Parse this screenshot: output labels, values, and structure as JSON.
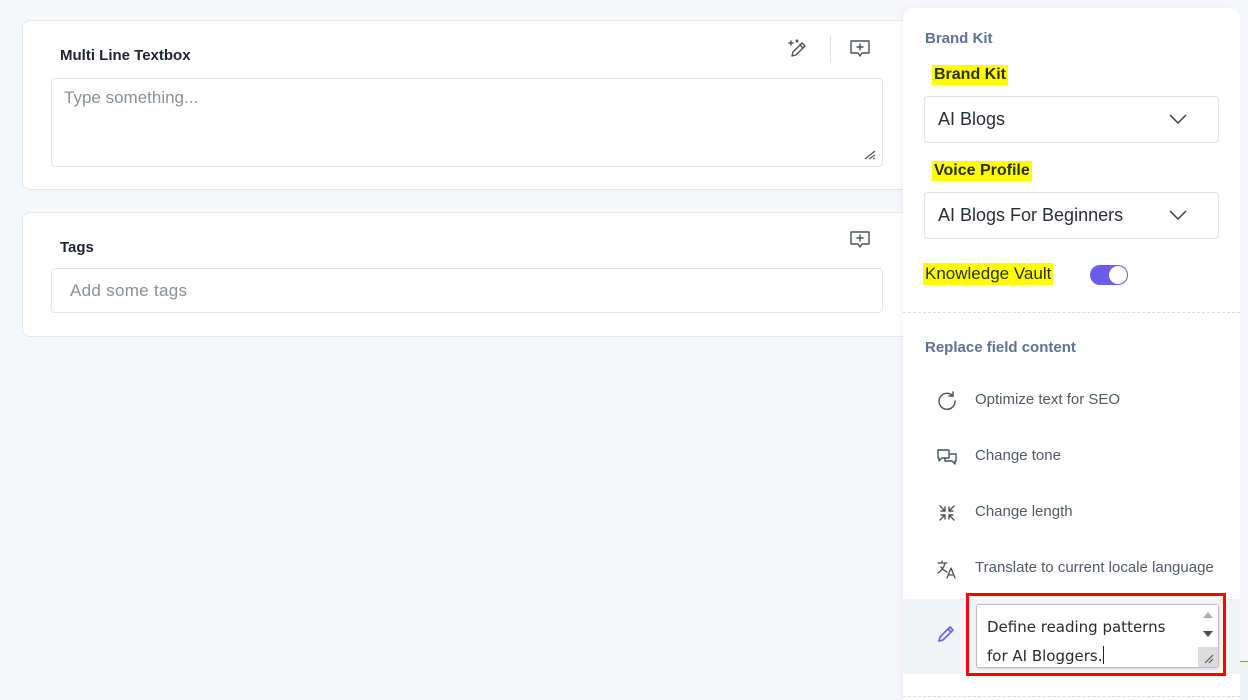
{
  "fields": {
    "multiline": {
      "label": "Multi Line Textbox",
      "placeholder": "Type something...",
      "value": ""
    },
    "tags": {
      "label": "Tags",
      "placeholder": "Add some tags"
    }
  },
  "icons": {
    "ai_write": "magic-pencil-icon",
    "add_comment": "add-comment-icon"
  },
  "panel": {
    "brand_kit_section_title": "Brand Kit",
    "brand_kit_label": "Brand Kit",
    "brand_kit_value": "AI Blogs",
    "voice_profile_label": "Voice Profile",
    "voice_profile_value": "AI Blogs For Beginners",
    "knowledge_vault_label": "Knowledge Vault",
    "knowledge_vault_enabled": true,
    "replace_section_title": "Replace field content",
    "menu_items": [
      {
        "label": "Optimize text for SEO",
        "icon": "refresh-icon"
      },
      {
        "label": "Change tone",
        "icon": "chat-bubbles-icon"
      },
      {
        "label": "Change length",
        "icon": "compress-arrows-icon"
      },
      {
        "label": "Translate to current locale language",
        "icon": "translate-icon"
      }
    ],
    "custom_prompt": {
      "icon": "pencil-icon",
      "line1": "Define reading patterns",
      "line2": "for AI Bloggers."
    }
  },
  "colors": {
    "accent": "#6d5ce8",
    "highlight": "#ffff00",
    "section_title": "#5f7196",
    "annotation_box": "#ff0000"
  }
}
